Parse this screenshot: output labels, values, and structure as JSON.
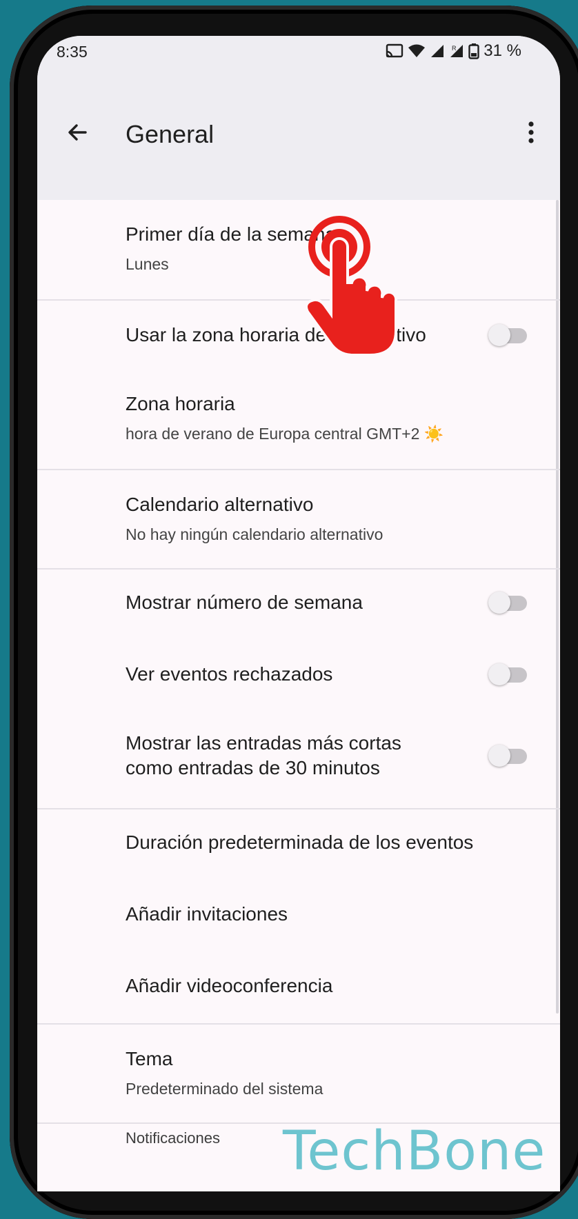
{
  "status_bar": {
    "time": "8:35",
    "battery": "31 %"
  },
  "app_bar": {
    "title": "General"
  },
  "settings": {
    "first_day": {
      "title": "Primer día de la semana",
      "value": "Lunes"
    },
    "device_tz": {
      "title": "Usar la zona horaria del dispositivo",
      "enabled": false
    },
    "timezone": {
      "title": "Zona horaria",
      "value": "hora de verano de Europa central  GMT+2 ☀️"
    },
    "alt_calendar": {
      "title": "Calendario alternativo",
      "value": "No hay ningún calendario alternativo"
    },
    "week_number": {
      "title": "Mostrar número de semana",
      "enabled": false
    },
    "declined_events": {
      "title": "Ver eventos rechazados",
      "enabled": false
    },
    "short_entries": {
      "title_line1": "Mostrar las entradas más cortas",
      "title_line2": "como entradas de 30 minutos",
      "enabled": false
    },
    "default_duration": {
      "title": "Duración predeterminada de los eventos"
    },
    "add_invites": {
      "title": "Añadir invitaciones"
    },
    "add_video": {
      "title": "Añadir videoconferencia"
    },
    "theme": {
      "title": "Tema",
      "value": "Predeterminado del sistema"
    },
    "notifications_header": "Notificaciones"
  },
  "watermark": "TechBone",
  "colors": {
    "background": "#167a8a",
    "accent_hand": "#e8211d",
    "watermark": "#6ec4cf"
  },
  "icons": [
    "arrow-back-icon",
    "more-vert-icon",
    "cast-icon",
    "wifi-icon",
    "signal-icon",
    "battery-icon",
    "tap-hand-icon"
  ]
}
